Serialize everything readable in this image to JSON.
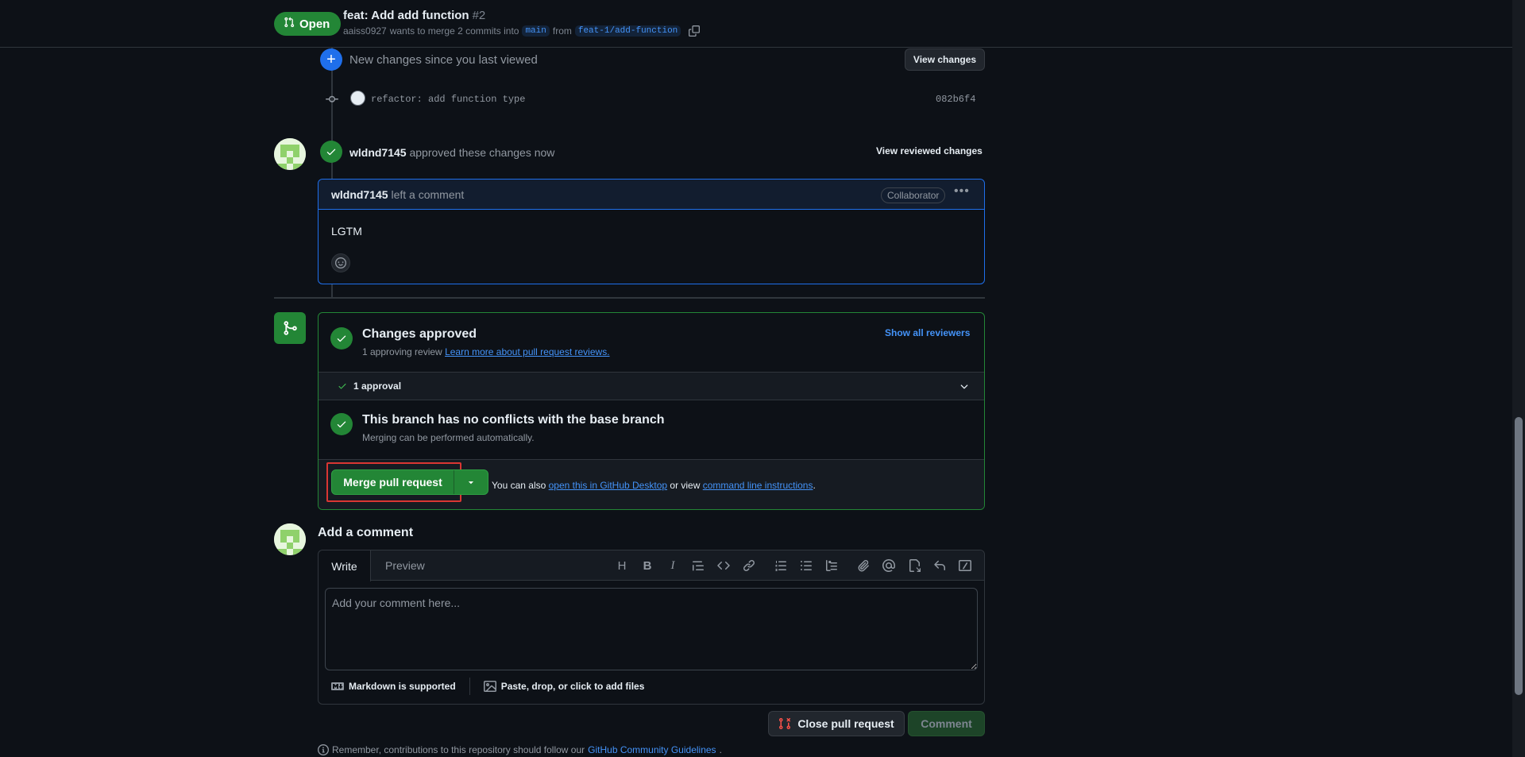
{
  "header": {
    "state": "Open",
    "title": "feat: Add add function",
    "number": "#2",
    "author": "aaiss0927",
    "merge_text": "wants to merge 2 commits into",
    "base_branch": "main",
    "from_text": "from",
    "head_branch": "feat-1/add-function"
  },
  "timeline": {
    "new_changes": "New changes since you last viewed",
    "view_changes": "View changes",
    "commit_message": "refactor: add function type",
    "commit_sha": "082b6f4",
    "reviewer": "wldnd7145",
    "review_action": "approved these changes now",
    "view_reviewed": "View reviewed changes"
  },
  "comment": {
    "author": "wldnd7145",
    "action": "left a comment",
    "badge": "Collaborator",
    "body": "LGTM"
  },
  "merge": {
    "approved_title": "Changes approved",
    "approved_sub": "1 approving review",
    "approved_link": "Learn more about pull request reviews.",
    "show_reviewers": "Show all reviewers",
    "approval_count": "1 approval",
    "conflict_title": "This branch has no conflicts with the base branch",
    "conflict_sub": "Merging can be performed automatically.",
    "merge_button": "Merge pull request",
    "help_prefix": "You can also",
    "help_link1": "open this in GitHub Desktop",
    "help_mid": "or view",
    "help_link2": "command line instructions",
    "help_suffix": "."
  },
  "add_comment": {
    "title": "Add a comment",
    "tab_write": "Write",
    "tab_preview": "Preview",
    "placeholder": "Add your comment here...",
    "markdown": "Markdown is supported",
    "attach": "Paste, drop, or click to add files",
    "close_button": "Close pull request",
    "comment_button": "Comment",
    "guidelines_prefix": "Remember, contributions to this repository should follow our",
    "guidelines_link": "GitHub Community Guidelines",
    "guidelines_suffix": "."
  },
  "colors": {
    "green": "#238636",
    "blue": "#1f6feb",
    "link": "#4493f8",
    "highlight": "#da3633"
  }
}
